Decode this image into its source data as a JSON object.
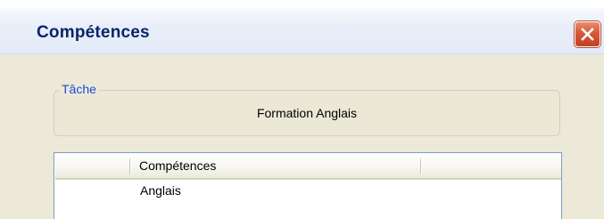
{
  "window": {
    "title": "Compétences",
    "close_icon": "close-icon",
    "accent_color": "#0a246a",
    "close_color": "#d4583a"
  },
  "task_group": {
    "legend": "Tâche",
    "value": "Formation Anglais",
    "legend_color": "#1c4bd6"
  },
  "list": {
    "columns": [
      "",
      "Compétences",
      ""
    ],
    "rows": [
      [
        "",
        "Anglais",
        ""
      ]
    ]
  }
}
